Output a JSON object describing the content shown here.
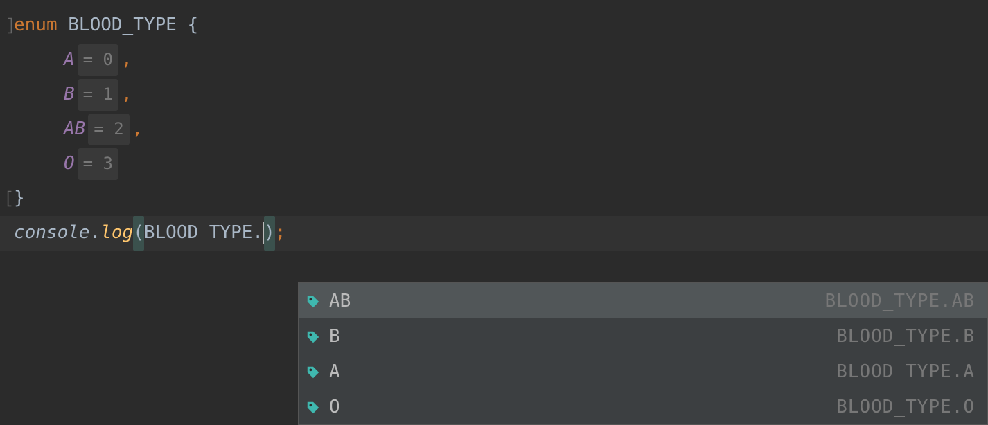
{
  "code": {
    "keyword_enum": "enum",
    "enum_name": "BLOOD_TYPE",
    "open_brace": "{",
    "close_brace": "}",
    "members": {
      "a": {
        "name": "A",
        "hint": "= 0"
      },
      "b": {
        "name": "B",
        "hint": "= 1"
      },
      "ab": {
        "name": "AB",
        "hint": "= 2"
      },
      "o": {
        "name": "O",
        "hint": "= 3"
      }
    },
    "comma": ",",
    "current_line": {
      "ident_console": "console",
      "dot": ".",
      "method_log": "log",
      "open_paren": "(",
      "arg_ref": "BLOOD_TYPE",
      "arg_dot": ".",
      "close_paren": ")",
      "semi": ";"
    }
  },
  "autocomplete": {
    "items": [
      {
        "label": "AB",
        "right": "BLOOD_TYPE.AB",
        "selected": true
      },
      {
        "label": "B",
        "right": "BLOOD_TYPE.B",
        "selected": false
      },
      {
        "label": "A",
        "right": "BLOOD_TYPE.A",
        "selected": false
      },
      {
        "label": "O",
        "right": "BLOOD_TYPE.O",
        "selected": false
      }
    ]
  }
}
